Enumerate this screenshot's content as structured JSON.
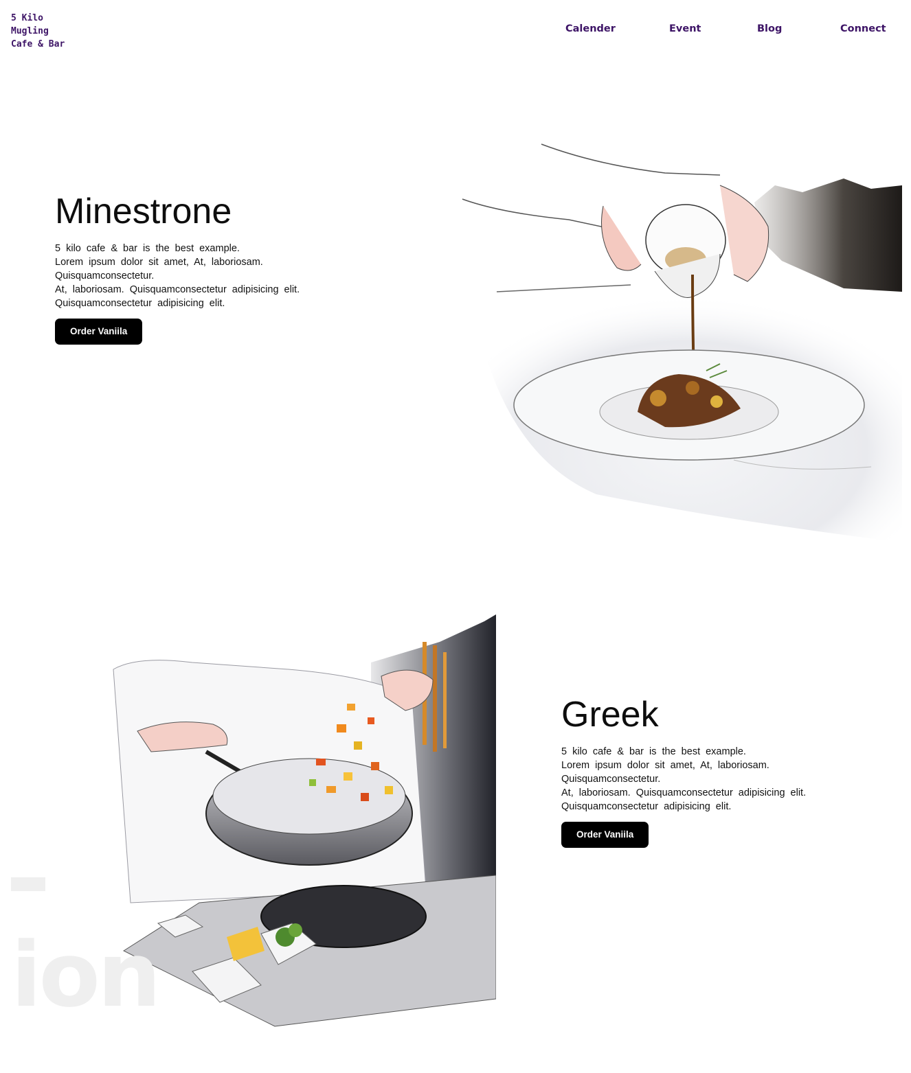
{
  "brand": {
    "lines": [
      "5 Kilo",
      "Mugling",
      "Cafe & Bar"
    ]
  },
  "nav": {
    "items": [
      "Calender",
      "Event",
      "Blog",
      "Connect"
    ]
  },
  "dishes": [
    {
      "title": "Minestrone",
      "lines": [
        "5 kilo cafe & bar is the best example.",
        "Lorem ipsum dolor sit amet, At, laboriosam.",
        "Quisquamconsectetur.",
        "At, laboriosam. Quisquamconsectetur adipisicing elit.",
        "Quisquamconsectetur adipisicing elit."
      ],
      "button": "Order Vaniila",
      "image": "chef-pouring-sauce-illustration"
    },
    {
      "title": "Greek",
      "lines": [
        "5 kilo cafe & bar is the best example.",
        "Lorem ipsum dolor sit amet, At, laboriosam.",
        "Quisquamconsectetur.",
        "At, laboriosam. Quisquamconsectetur adipisicing elit.",
        "Quisquamconsectetur adipisicing elit."
      ],
      "button": "Order Vaniila",
      "image": "chef-tossing-wok-illustration"
    }
  ],
  "watermark": {
    "text": "ion"
  },
  "colors": {
    "nav": "#3d1466",
    "button": "#000000",
    "button_text": "#ffffff"
  }
}
